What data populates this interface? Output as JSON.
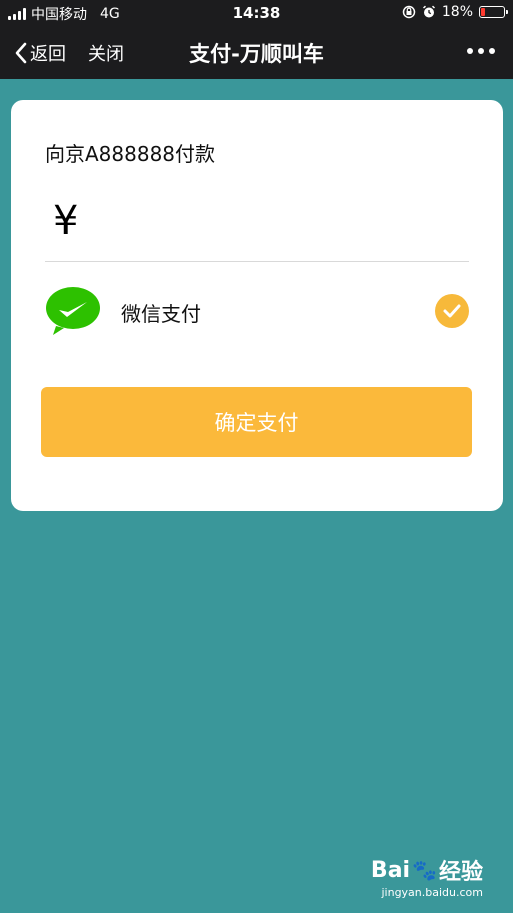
{
  "status_bar": {
    "carrier": "中国移动",
    "network": "4G",
    "time": "14:38",
    "battery": "18%",
    "battery_level": 0.18,
    "battery_color": "#ff3b30"
  },
  "nav": {
    "back_label": "返回",
    "close_label": "关闭",
    "title": "支付-万顺叫车",
    "more_icon": "more-dots-icon"
  },
  "payment": {
    "payee": "向京A888888付款",
    "currency_symbol": "¥",
    "amount": ""
  },
  "method": {
    "label": "微信支付",
    "icon": "wechat-pay-icon",
    "selected": true,
    "accent_color": "#f7b93a"
  },
  "confirm": {
    "label": "确定支付",
    "color": "#fbb93b"
  },
  "watermark": {
    "brand": "Bai",
    "brand_cn": "经验",
    "site": "jingyan.baidu.com"
  },
  "colors": {
    "background": "#3a979a",
    "bar": "#1c1c1e"
  }
}
